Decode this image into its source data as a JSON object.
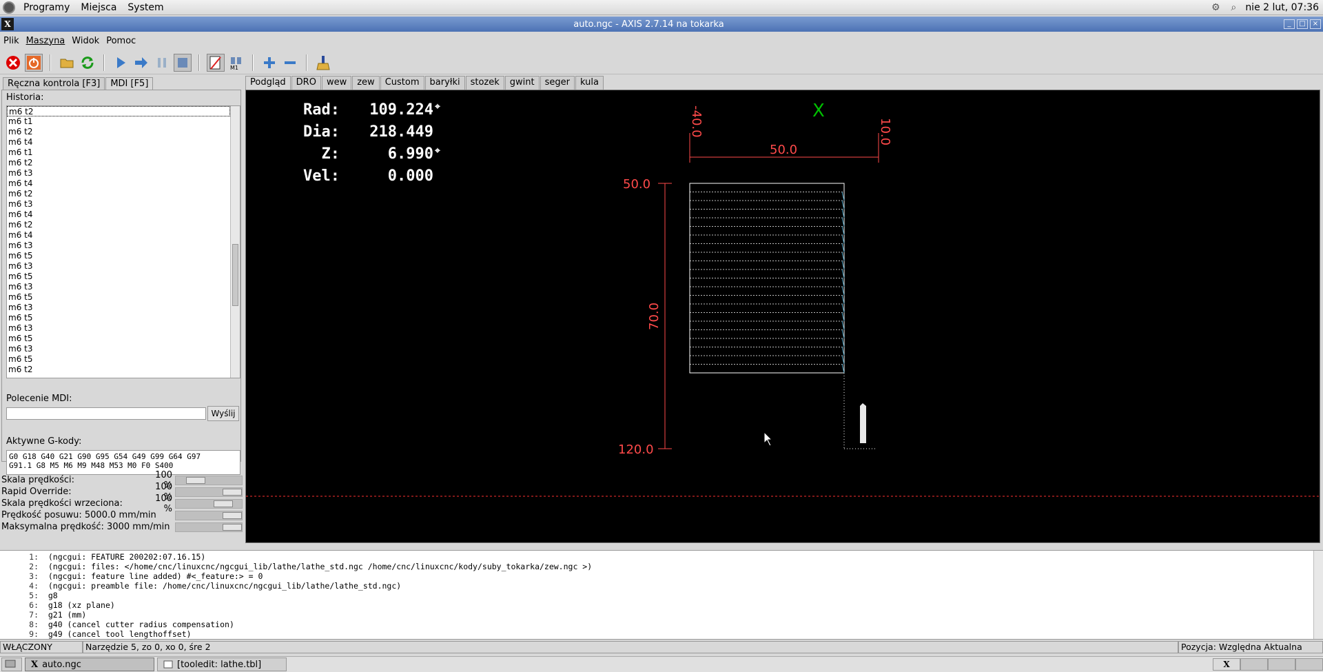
{
  "top_panel": {
    "menus": [
      "Programy",
      "Miejsca",
      "System"
    ],
    "clock": "nie  2 lut, 07:36"
  },
  "window": {
    "title": "auto.ngc - AXIS 2.7.14 na tokarka"
  },
  "menubar": [
    "Plik",
    "Maszyna",
    "Widok",
    "Pomoc"
  ],
  "toolbar": {
    "estop_icon": "estop-icon",
    "power_icon": "power-icon",
    "open_icon": "folder-open-icon",
    "reload_icon": "reload-icon"
  },
  "left_tabs": [
    "Ręczna kontrola [F3]",
    "MDI [F5]"
  ],
  "mdi": {
    "history_label": "Historia:",
    "history": [
      "m6 t2",
      "m6 t1",
      "m6 t2",
      "m6 t4",
      "m6 t1",
      "m6 t2",
      "m6 t3",
      "m6 t4",
      "m6 t2",
      "m6 t3",
      "m6 t4",
      "m6 t2",
      "m6 t4",
      "m6 t3",
      "m6 t5",
      "m6 t3",
      "m6 t5",
      "m6 t3",
      "m6 t5",
      "m6 t3",
      "m6 t5",
      "m6 t3",
      "m6 t5",
      "m6 t3",
      "m6 t5",
      "m6 t2"
    ],
    "command_label": "Polecenie MDI:",
    "command_value": "",
    "send_label": "Wyślij",
    "active_label": "Aktywne G-kody:",
    "active_line1": "G0 G18 G40 G21 G90 G95 G54 G49 G99 G64 G97",
    "active_line2": "G91.1 G8 M5 M6 M9 M48 M53 M0 F0 S400"
  },
  "overrides": [
    {
      "name": "Skala prędkości:",
      "value": "100 %",
      "level": 0.2
    },
    {
      "name": "Rapid Override:",
      "value": "100 %",
      "level": 1.0
    },
    {
      "name": "Skala prędkości wrzeciona:",
      "value": "100 %",
      "level": 0.8
    },
    {
      "name": "Prędkość posuwu:  5000.0 mm/min",
      "value": "",
      "level": 1.0
    },
    {
      "name": "Maksymalna prędkość:  3000 mm/min",
      "value": "",
      "level": 1.0
    }
  ],
  "right_tabs": [
    "Podgląd",
    "DRO",
    "wew",
    "zew",
    "Custom",
    "baryłki",
    "stozek",
    "gwint",
    "seger",
    "kula"
  ],
  "dro": {
    "rows": [
      {
        "k": "Rad:",
        "v": "109.224",
        "marker": "⌖"
      },
      {
        "k": "Dia:",
        "v": "218.449",
        "marker": ""
      },
      {
        "k": "Z:",
        "v": "6.990",
        "marker": "⌖"
      },
      {
        "k": "Vel:",
        "v": "0.000",
        "marker": ""
      }
    ]
  },
  "preview": {
    "axis_label": "X",
    "dim_top_left": "-40.0",
    "dim_top_right": "10.0",
    "dim_width": "50.0",
    "dim_y_top": "50.0",
    "dim_y_bottom": "120.0",
    "dim_height": "70.0",
    "colors": {
      "dim": "#ff4a4a",
      "axis": "#00c000",
      "path": "#ffffff",
      "rapid": "#4aa0c0"
    }
  },
  "console": [
    {
      "n": "1:",
      "t": "(ngcgui: FEATURE 200202:07.16.15)"
    },
    {
      "n": "2:",
      "t": "(ngcgui: files: </home/cnc/linuxcnc/ngcgui_lib/lathe/lathe_std.ngc /home/cnc/linuxcnc/kody/suby_tokarka/zew.ngc >)"
    },
    {
      "n": "3:",
      "t": "(ngcgui: feature line added) #<_feature:> = 0"
    },
    {
      "n": "4:",
      "t": "(ngcgui: preamble file: /home/cnc/linuxcnc/ngcgui_lib/lathe/lathe_std.ngc)"
    },
    {
      "n": "5:",
      "t": "g8"
    },
    {
      "n": "6:",
      "t": "g18 (xz plane)"
    },
    {
      "n": "7:",
      "t": "g21 (mm)"
    },
    {
      "n": "8:",
      "t": "g40 (cancel cutter radius compensation)"
    },
    {
      "n": "9:",
      "t": "g49 (cancel tool lengthoffset)"
    }
  ],
  "status": {
    "state": "WŁĄCZONY",
    "tool": "Narzędzie 5, zo 0, xo 0, śre 2",
    "position": "Pozycja: Względna Aktualna"
  },
  "taskbar": {
    "tasks": [
      "auto.ngc",
      "[tooledit: lathe.tbl]"
    ]
  }
}
